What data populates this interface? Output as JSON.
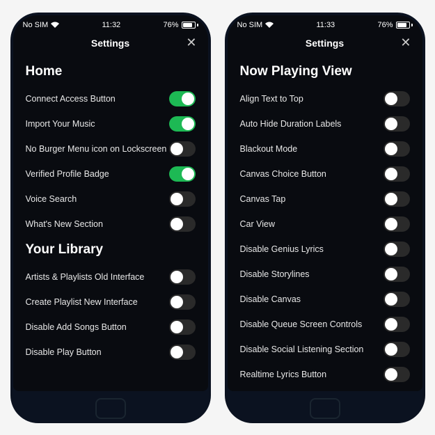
{
  "phones": [
    {
      "status": {
        "carrier": "No SIM",
        "time": "11:32",
        "battery": "76%"
      },
      "header": {
        "title": "Settings"
      },
      "sections": [
        {
          "title": "Home",
          "items": [
            {
              "label": "Connect Access Button",
              "on": true
            },
            {
              "label": "Import Your Music",
              "on": true
            },
            {
              "label": "No Burger Menu icon on Lockscreen",
              "on": false
            },
            {
              "label": "Verified Profile Badge",
              "on": true
            },
            {
              "label": "Voice Search",
              "on": false
            },
            {
              "label": "What's New Section",
              "on": false
            }
          ]
        },
        {
          "title": "Your Library",
          "items": [
            {
              "label": "Artists & Playlists Old Interface",
              "on": false
            },
            {
              "label": "Create Playlist New Interface",
              "on": false
            },
            {
              "label": "Disable Add Songs Button",
              "on": false
            },
            {
              "label": "Disable Play Button",
              "on": false
            }
          ]
        }
      ]
    },
    {
      "status": {
        "carrier": "No SIM",
        "time": "11:33",
        "battery": "76%"
      },
      "header": {
        "title": "Settings"
      },
      "sections": [
        {
          "title": "Now Playing View",
          "items": [
            {
              "label": "Align Text to Top",
              "on": false
            },
            {
              "label": "Auto Hide Duration Labels",
              "on": false
            },
            {
              "label": "Blackout Mode",
              "on": false
            },
            {
              "label": "Canvas Choice Button",
              "on": false
            },
            {
              "label": "Canvas Tap",
              "on": false
            },
            {
              "label": "Car View",
              "on": false
            },
            {
              "label": "Disable Genius Lyrics",
              "on": false
            },
            {
              "label": "Disable Storylines",
              "on": false
            },
            {
              "label": "Disable Canvas",
              "on": false
            },
            {
              "label": "Disable Queue Screen Controls",
              "on": false
            },
            {
              "label": "Disable Social Listening Section",
              "on": false
            },
            {
              "label": "Realtime Lyrics Button",
              "on": false
            }
          ]
        }
      ]
    }
  ]
}
